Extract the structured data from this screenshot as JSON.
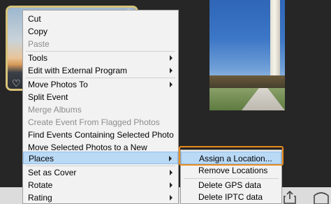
{
  "context_menu": {
    "items": [
      {
        "label": "Cut"
      },
      {
        "label": "Copy"
      },
      {
        "label": "Paste"
      },
      {
        "label": "Tools"
      },
      {
        "label": "Edit with External Program"
      },
      {
        "label": "Move Photos To"
      },
      {
        "label": "Split Event"
      },
      {
        "label": "Merge Albums"
      },
      {
        "label": "Create Event From Flagged Photos"
      },
      {
        "label": "Find Events Containing Selected Photo"
      },
      {
        "label": "Move Selected Photos to a New Album..."
      },
      {
        "label": "Places"
      },
      {
        "label": "Set as Cover"
      },
      {
        "label": "Rotate"
      },
      {
        "label": "Rating"
      }
    ]
  },
  "places_submenu": {
    "items": [
      {
        "label": "Assign a Location..."
      },
      {
        "label": "Remove Locations"
      },
      {
        "label": "Delete GPS data"
      },
      {
        "label": "Delete IPTC data"
      }
    ]
  },
  "colors": {
    "highlight": "#b9d9f5",
    "callout_outline": "#e98c1f",
    "thumbnail_border": "#d8c27a"
  },
  "icons": [
    "heart-icon",
    "share-icon",
    "box-icon",
    "submenu-arrow-icon"
  ]
}
